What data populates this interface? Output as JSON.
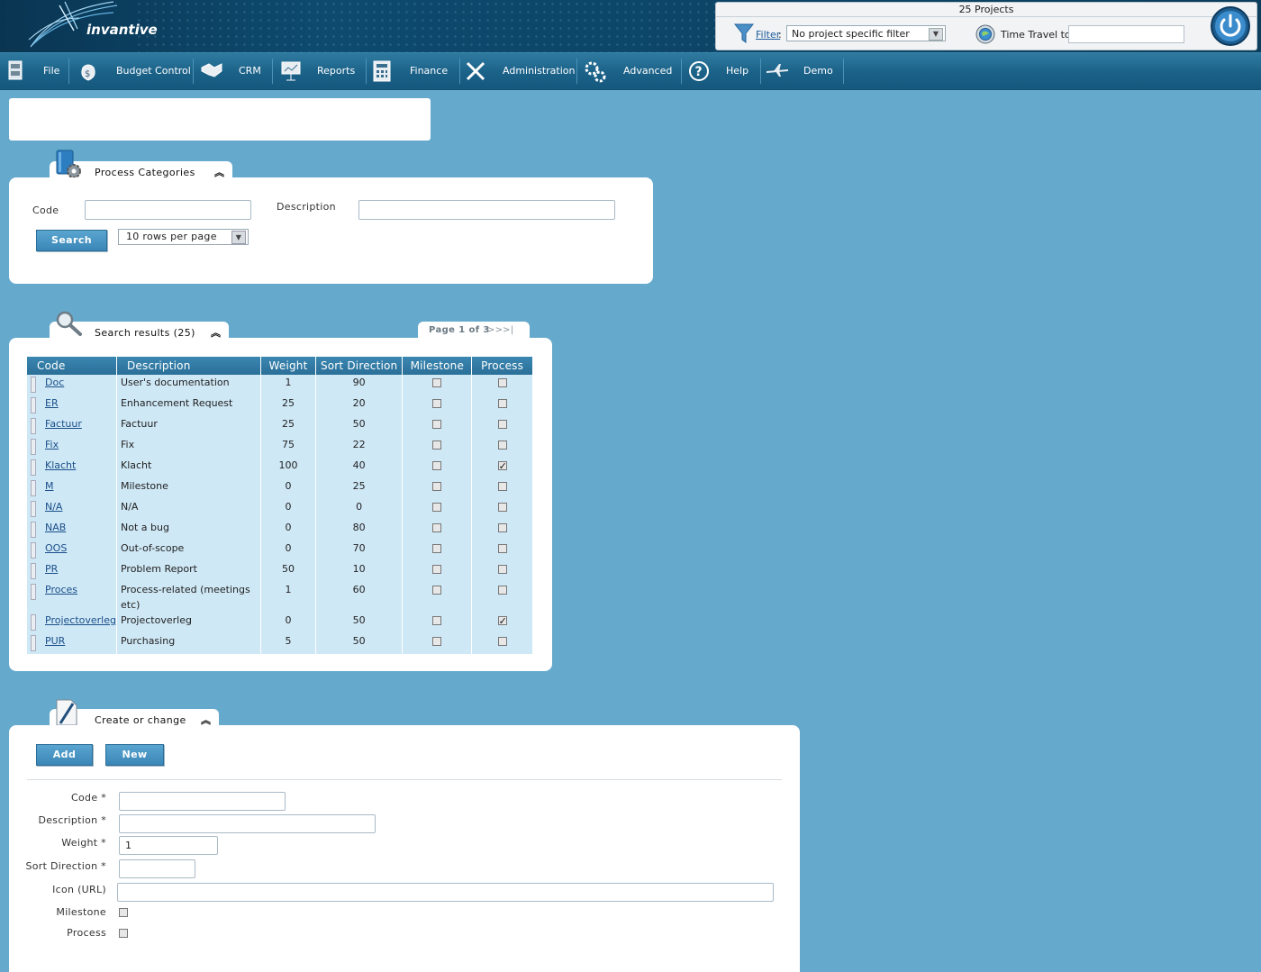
{
  "header": {
    "logo_text": "invantive",
    "projects_label": "25 Projects",
    "filter_label": "Filter",
    "filter_colon": ":",
    "filter_value": "No project specific filter",
    "time_travel_label": "Time Travel to:",
    "time_travel_value": ""
  },
  "menu": [
    {
      "label": "File",
      "icon": "file-cabinet-icon"
    },
    {
      "label": "Budget Control",
      "icon": "money-bag-icon"
    },
    {
      "label": "CRM",
      "icon": "handshake-icon"
    },
    {
      "label": "Reports",
      "icon": "presentation-board-icon"
    },
    {
      "label": "Finance",
      "icon": "calculator-icon"
    },
    {
      "label": "Administration",
      "icon": "tools-icon"
    },
    {
      "label": "Advanced",
      "icon": "gears-icon"
    },
    {
      "label": "Help",
      "icon": "question-mark-icon"
    },
    {
      "label": "Demo",
      "icon": "airplane-icon"
    }
  ],
  "process_categories": {
    "title": "Process Categories",
    "collapse": "︽",
    "code_label": "Code",
    "code_value": "",
    "description_label": "Description",
    "description_value": "",
    "search_button": "Search",
    "rows_per_page": "10 rows per page"
  },
  "search_results": {
    "title": "Search results (25)",
    "collapse": "︽",
    "pager": "Page 1 of 3",
    "pager_next": ">>",
    "pager_last": ">|",
    "columns": [
      "Code",
      "Description",
      "Weight",
      "Sort Direction",
      "Milestone",
      "Process"
    ],
    "rows": [
      {
        "code": "Doc",
        "description": "User's documentation",
        "weight": "1",
        "sort": "90",
        "milestone": false,
        "process": false
      },
      {
        "code": "ER",
        "description": "Enhancement Request",
        "weight": "25",
        "sort": "20",
        "milestone": false,
        "process": false
      },
      {
        "code": "Factuur",
        "description": "Factuur",
        "weight": "25",
        "sort": "50",
        "milestone": false,
        "process": false
      },
      {
        "code": "Fix",
        "description": "Fix",
        "weight": "75",
        "sort": "22",
        "milestone": false,
        "process": false
      },
      {
        "code": "Klacht",
        "description": "Klacht",
        "weight": "100",
        "sort": "40",
        "milestone": false,
        "process": true
      },
      {
        "code": "M",
        "description": "Milestone",
        "weight": "0",
        "sort": "25",
        "milestone": false,
        "process": false
      },
      {
        "code": "N/A",
        "description": "N/A",
        "weight": "0",
        "sort": "0",
        "milestone": false,
        "process": false
      },
      {
        "code": "NAB",
        "description": "Not a bug",
        "weight": "0",
        "sort": "80",
        "milestone": false,
        "process": false
      },
      {
        "code": "OOS",
        "description": "Out-of-scope",
        "weight": "0",
        "sort": "70",
        "milestone": false,
        "process": false
      },
      {
        "code": "PR",
        "description": "Problem Report",
        "weight": "50",
        "sort": "10",
        "milestone": false,
        "process": false
      },
      {
        "code": "Proces",
        "description": "Process-related (meetings etc)",
        "weight": "1",
        "sort": "60",
        "milestone": false,
        "process": false
      },
      {
        "code": "Projectoverleg",
        "description": "Projectoverleg",
        "weight": "0",
        "sort": "50",
        "milestone": false,
        "process": true
      },
      {
        "code": "PUR",
        "description": "Purchasing",
        "weight": "5",
        "sort": "50",
        "milestone": false,
        "process": false
      }
    ]
  },
  "create_change": {
    "title": "Create or change",
    "collapse": "︽",
    "add_button": "Add",
    "new_button": "New",
    "code_label": "Code *",
    "code_value": "",
    "description_label": "Description *",
    "description_value": "",
    "weight_label": "Weight *",
    "weight_value": "1",
    "sort_label": "Sort Direction *",
    "sort_value": "",
    "icon_label": "Icon (URL)",
    "icon_value": "",
    "milestone_label": "Milestone",
    "milestone_checked": false,
    "process_label": "Process",
    "process_checked": false
  },
  "colors": {
    "page_background": "#65a9cc",
    "header_dark": "#0b3d5c",
    "menu_blue": "#1b6188",
    "table_header": "#2f7aa3",
    "table_row": "#cfe8f6",
    "button_blue": "#4a96c4"
  }
}
